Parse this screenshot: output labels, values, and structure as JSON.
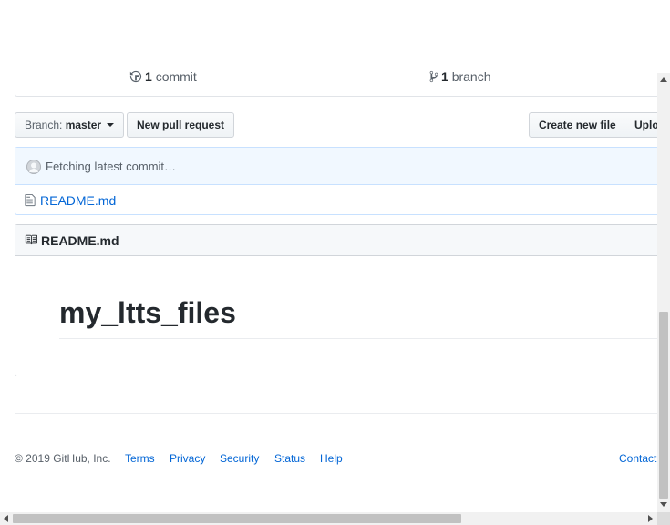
{
  "summary": {
    "commits_count": "1",
    "commits_label": "commit",
    "branches_count": "1",
    "branches_label": "branch"
  },
  "file_nav": {
    "branch_prefix": "Branch:",
    "branch_name": "master",
    "new_pr": "New pull request",
    "create_file": "Create new file",
    "upload": "Uplo"
  },
  "commit_tease": {
    "text": "Fetching latest commit…"
  },
  "files": [
    {
      "name": "README.md",
      "icon": "file-icon"
    }
  ],
  "readme": {
    "header": "README.md",
    "title": "my_ltts_files"
  },
  "footer": {
    "copyright": "© 2019 GitHub, Inc.",
    "links": [
      "Terms",
      "Privacy",
      "Security",
      "Status",
      "Help"
    ],
    "right_link": "Contact"
  },
  "colors": {
    "link": "#0366d6",
    "commit_bg": "#f1f8ff",
    "border_blue": "#c8e1ff"
  }
}
